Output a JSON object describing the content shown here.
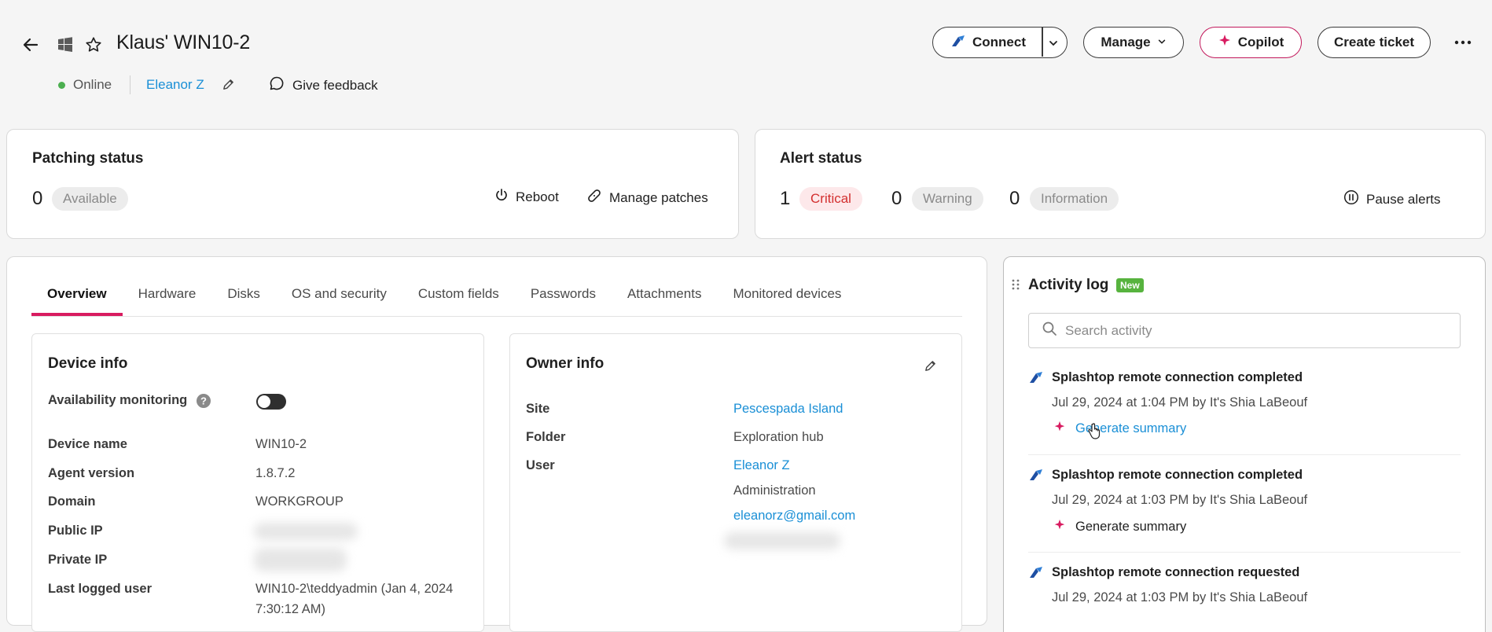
{
  "header": {
    "title": "Klaus' WIN10-2",
    "status": "Online",
    "assignee": "Eleanor Z",
    "feedback_label": "Give feedback",
    "buttons": {
      "connect": "Connect",
      "manage": "Manage",
      "copilot": "Copilot",
      "create_ticket": "Create ticket"
    }
  },
  "patching": {
    "title": "Patching status",
    "count": "0",
    "pill": "Available",
    "reboot": "Reboot",
    "manage_patches": "Manage patches"
  },
  "alerts": {
    "title": "Alert status",
    "critical_count": "1",
    "critical_label": "Critical",
    "warning_count": "0",
    "warning_label": "Warning",
    "info_count": "0",
    "info_label": "Information",
    "pause_label": "Pause alerts"
  },
  "tabs": [
    "Overview",
    "Hardware",
    "Disks",
    "OS and security",
    "Custom fields",
    "Passwords",
    "Attachments",
    "Monitored devices"
  ],
  "device_info": {
    "title": "Device info",
    "availability_label": "Availability monitoring",
    "rows": [
      {
        "label": "Device name",
        "value": "WIN10-2"
      },
      {
        "label": "Agent version",
        "value": "1.8.7.2"
      },
      {
        "label": "Domain",
        "value": "WORKGROUP"
      },
      {
        "label": "Public IP",
        "value": ""
      },
      {
        "label": "Private IP",
        "value": ""
      },
      {
        "label": "Last logged user",
        "value": "WIN10-2\\teddyadmin (Jan 4, 2024",
        "value2": "7:30:12 AM)"
      }
    ]
  },
  "owner_info": {
    "title": "Owner info",
    "site_label": "Site",
    "site_value": "Pescespada Island",
    "folder_label": "Folder",
    "folder_value": "Exploration hub",
    "user_label": "User",
    "user_name": "Eleanor Z",
    "user_role": "Administration",
    "user_email": "eleanorz@gmail.com"
  },
  "activity": {
    "title": "Activity log",
    "badge": "New",
    "search_placeholder": "Search activity",
    "items": [
      {
        "title": "Splashtop remote connection completed",
        "meta": "Jul 29, 2024 at 1:04 PM by It's Shia LaBeouf",
        "action": "Generate summary"
      },
      {
        "title": "Splashtop remote connection completed",
        "meta": "Jul 29, 2024 at 1:03 PM by It's Shia LaBeouf",
        "action": "Generate summary"
      },
      {
        "title": "Splashtop remote connection requested",
        "meta": "Jul 29, 2024 at 1:03 PM by It's Shia LaBeouf"
      }
    ]
  },
  "colors": {
    "accent": "#d81b60",
    "link": "#1a8fd6",
    "online": "#4caf50",
    "critical": "#d32f2f",
    "new_badge": "#57b33e"
  }
}
